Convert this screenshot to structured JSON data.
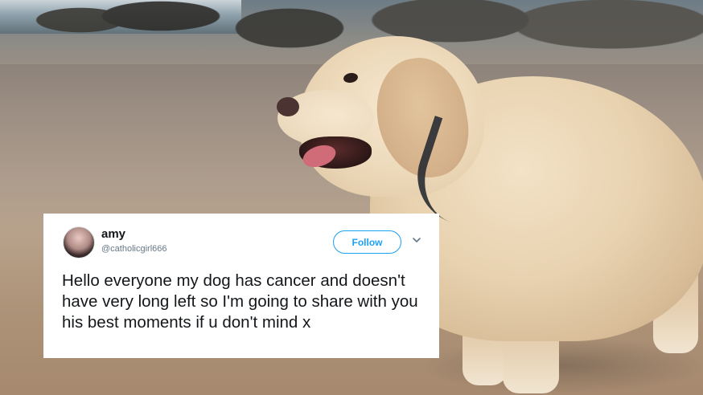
{
  "tweet": {
    "display_name": "amy",
    "handle": "@catholicgirl666",
    "follow_label": "Follow",
    "menu_icon": "chevron-down-icon",
    "text": "Hello everyone my dog has cancer and doesn't have very long left so I'm going to share with you his best moments if u don't mind x",
    "accent_color": "#1da1f2"
  },
  "background": {
    "image": "golden-retriever-on-beach"
  }
}
